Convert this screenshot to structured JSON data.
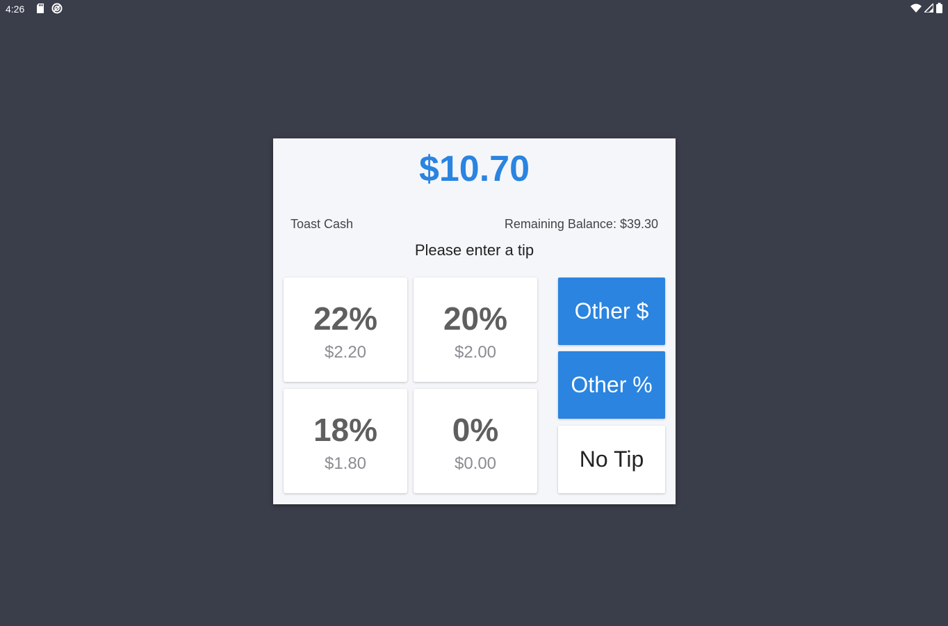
{
  "status_bar": {
    "time": "4:26",
    "left_icons": [
      "sd-card-icon",
      "sync-icon"
    ],
    "right_icons": [
      "wifi-icon",
      "signal-icon",
      "battery-icon"
    ]
  },
  "dialog": {
    "amount": "$10.70",
    "payment_method": "Toast Cash",
    "remaining_balance": "Remaining Balance: $39.30",
    "prompt": "Please enter a tip",
    "tip_options": [
      {
        "percent": "22%",
        "amount": "$2.20"
      },
      {
        "percent": "20%",
        "amount": "$2.00"
      },
      {
        "percent": "18%",
        "amount": "$1.80"
      },
      {
        "percent": "0%",
        "amount": "$0.00"
      }
    ],
    "other_dollar_label": "Other $",
    "other_percent_label": "Other %",
    "no_tip_label": "No Tip"
  },
  "colors": {
    "background": "#3a3d4a",
    "accent": "#2a84e0",
    "dialog_bg": "#f5f6fa"
  }
}
